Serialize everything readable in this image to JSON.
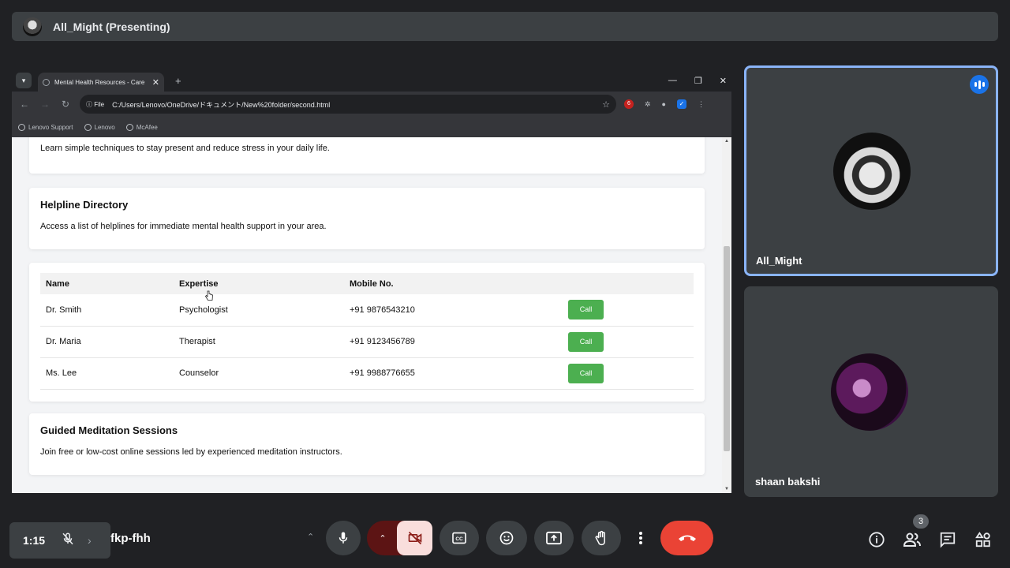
{
  "meet": {
    "presenter_title": "All_Might (Presenting)",
    "clock": "1:15",
    "meeting_code": "fkp-fhh",
    "participant_count": "3",
    "accent_color": "#8ab4f8",
    "end_call_color": "#ea4335"
  },
  "browser": {
    "tab_title": "Mental Health Resources - Care",
    "new_tab": "+",
    "file_chip": "File",
    "url": "C:/Users/Lenovo/OneDrive/ドキュメント/New%20folder/second.html",
    "extension_badge": "6",
    "bookmarks": [
      "Lenovo Support",
      "Lenovo",
      "McAfee"
    ]
  },
  "page": {
    "mindfulness_text": "Learn simple techniques to stay present and reduce stress in your daily life.",
    "helpline_title": "Helpline Directory",
    "helpline_text": "Access a list of helplines for immediate mental health support in your area.",
    "table": {
      "headers": [
        "Name",
        "Expertise",
        "Mobile No."
      ],
      "rows": [
        {
          "name": "Dr. Smith",
          "expertise": "Psychologist",
          "mobile": "+91 9876543210",
          "action": "Call"
        },
        {
          "name": "Dr. Maria",
          "expertise": "Therapist",
          "mobile": "+91 9123456789",
          "action": "Call"
        },
        {
          "name": "Ms. Lee",
          "expertise": "Counselor",
          "mobile": "+91 9988776655",
          "action": "Call"
        }
      ],
      "call_color": "#4caf50"
    },
    "meditation_title": "Guided Meditation Sessions",
    "meditation_text": "Join free or low-cost online sessions led by experienced meditation instructors."
  },
  "participants": [
    {
      "name": "All_Might",
      "speaking": true
    },
    {
      "name": "shaan bakshi",
      "speaking": false
    }
  ]
}
